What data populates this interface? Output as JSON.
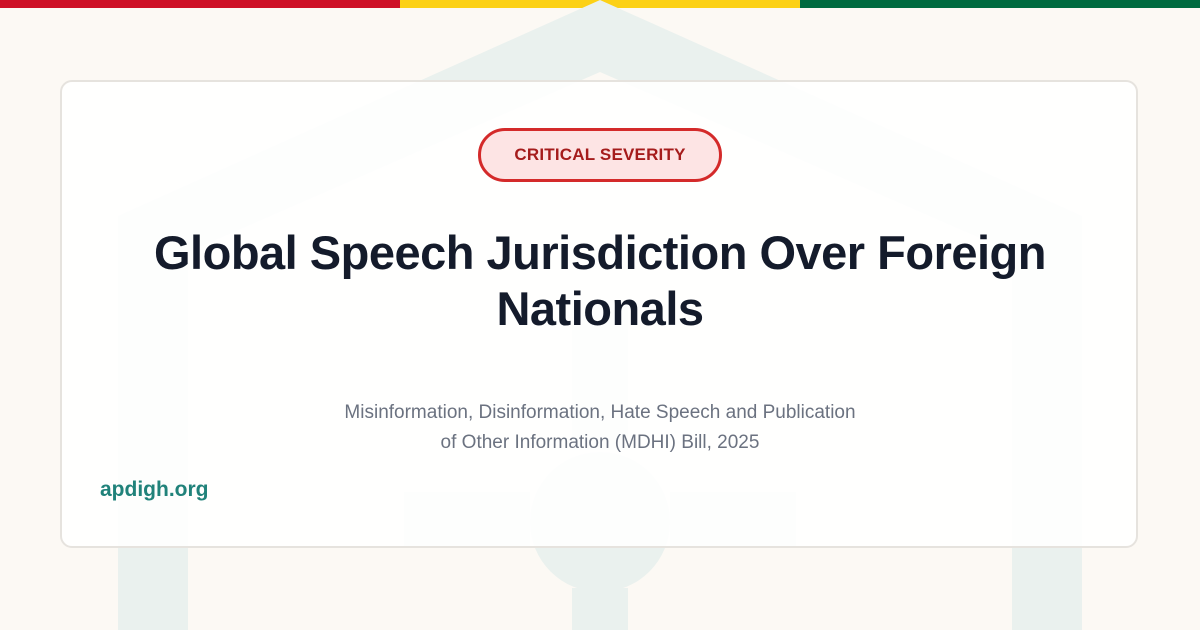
{
  "colors": {
    "flag_red": "#ce1126",
    "flag_yellow": "#fcd116",
    "flag_green": "#006b3f",
    "background": "#fcf9f4",
    "badge_text": "#a51c1c",
    "badge_border": "#d42a2a",
    "badge_fill": "#fde4e4",
    "title_text": "#141b2b",
    "subtitle_text": "#6b7280",
    "site_text": "#20827a",
    "watermark": "#eaf1ee"
  },
  "watermark_icon": "house-with-person-icon",
  "badge": {
    "label": "CRITICAL SEVERITY"
  },
  "title": {
    "line1": "Global Speech Jurisdiction Over Foreign",
    "line2": "Nationals"
  },
  "subtitle": {
    "line1": "Misinformation, Disinformation, Hate Speech and Publication",
    "line2": "of Other Information (MDHI) Bill, 2025"
  },
  "site": {
    "label": "apdigh.org"
  }
}
